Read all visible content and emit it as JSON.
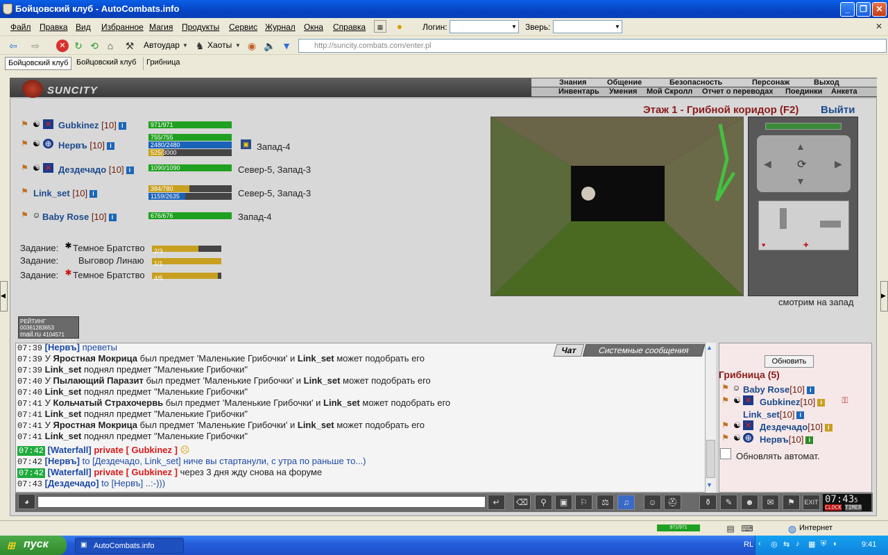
{
  "window": {
    "title": "Бойцовский клуб - AutoCombats.info"
  },
  "menu": {
    "items": [
      "Файл",
      "Правка",
      "Вид",
      "Избранное",
      "Магия",
      "Продукты",
      "Сервис",
      "Журнал",
      "Окна",
      "Справка"
    ],
    "login_label": "Логин:",
    "beast_label": "Зверь:"
  },
  "toolbar": {
    "autoudar": "Автоудар",
    "haoty": "Хаоты",
    "address": "http://suncity.combats.com/enter.pl"
  },
  "tabs": [
    "Бойцовский клуб",
    "Бойцовский клуб",
    "Грибница"
  ],
  "game": {
    "logo": "SUNCITY",
    "nav_top": [
      "Знания",
      "Общение",
      "Безопасность",
      "Персонаж",
      "Выход"
    ],
    "nav_bottom": [
      "Инвентарь",
      "Умения",
      "Мой Скролл",
      "Отчет о переводах",
      "Поединки",
      "Анкета"
    ],
    "floor": "Этаж 1 - Грибной коридор (F2)",
    "exit": "Выйти",
    "looking": "смотрим на запад",
    "party": [
      {
        "name": "Gubkinez",
        "level": "[10]",
        "hp": "971/971",
        "hp_frac": 1.0,
        "location": ""
      },
      {
        "name": "Нервъ",
        "level": "[10]",
        "hp": "755/755",
        "hp_frac": 1.0,
        "mana": "2480/2480",
        "mana_frac": 1.0,
        "extra": "525/3000",
        "extra_frac": 0.18,
        "location": "Запад-4"
      },
      {
        "name": "Дездечадо",
        "level": "[10]",
        "hp": "1090/1090",
        "hp_frac": 1.0,
        "location": "Север-5, Запад-3"
      },
      {
        "name": "Link_set",
        "level": "[10]",
        "hp": "384/780",
        "hp_frac": 0.49,
        "mana": "1159/2635",
        "mana_frac": 0.44,
        "location": "Север-5, Запад-3"
      },
      {
        "name": "Baby Rose",
        "level": "[10]",
        "hp": "676/676",
        "hp_frac": 1.0,
        "location": "Запад-4"
      }
    ],
    "quests": [
      {
        "label": "Задание:",
        "name": "Темное Братство",
        "progress": "2/3",
        "frac": 0.67
      },
      {
        "label": "Задание:",
        "name": "Выговор Линаю",
        "progress": "1/1",
        "frac": 1.0
      },
      {
        "label": "Задание:",
        "name": "Темное Братство",
        "progress": "4/5",
        "frac": 0.95
      }
    ],
    "rating": {
      "label": "РЕЙТИНГ",
      "v1": "00361283653",
      "v2": "4104571",
      "v3": "15321",
      "brand": "mail.ru"
    },
    "chat_tabs": [
      "Чат",
      "Системные сообщения"
    ],
    "chat": [
      {
        "time": "07:39",
        "a": "[Нервъ]",
        "b": " преветы"
      },
      {
        "time": "07:39",
        "pre": "У ",
        "who": "Яростная Мокрица",
        "mid": " был предмет 'Маленькие Грибочки' и ",
        "who2": "Link_set",
        "post": " может подобрать его"
      },
      {
        "time": "07:39",
        "who": "Link_set",
        "post": " поднял предмет \"Маленькие Грибочки\""
      },
      {
        "time": "07:40",
        "pre": "У ",
        "who": "Пылающий Паразит",
        "mid": " был предмет 'Маленькие Грибочки' и ",
        "who2": "Link_set",
        "post": " может подобрать его"
      },
      {
        "time": "07:40",
        "who": "Link_set",
        "post": " поднял предмет \"Маленькие Грибочки\""
      },
      {
        "time": "07:41",
        "pre": "У ",
        "who": "Кольчатый Страхочервь",
        "mid": " был предмет 'Маленькие Грибочки' и ",
        "who2": "Link_set",
        "post": " может подобрать его"
      },
      {
        "time": "07:41",
        "who": "Link_set",
        "post": " поднял предмет \"Маленькие Грибочки\""
      },
      {
        "time": "07:41",
        "pre": "У ",
        "who": "Яростная Мокрица",
        "mid": " был предмет 'Маленькие Грибочки' и ",
        "who2": "Link_set",
        "post": " может подобрать его"
      },
      {
        "time": "07:41",
        "who": "Link_set",
        "post": " поднял предмет \"Маленькие Грибочки\""
      }
    ],
    "chat_private": [
      {
        "time": "07:42",
        "who": "[Waterfall]",
        "priv": "private [ Gubkinez ]",
        "text": ""
      },
      {
        "time": "07:42",
        "who": "[Нервъ]",
        "to": " to [Дездечадо, Link_set] ниче вы стартанули, с утра по раньше то...)"
      },
      {
        "time": "07:42",
        "who": "[Waterfall]",
        "priv": "private [ Gubkinez ]",
        "text": " через 3 дня жду снова на форуме"
      },
      {
        "time": "07:43",
        "who": "[Дездечадо]",
        "to": " to [Нервъ] ..:-)))"
      }
    ],
    "side": {
      "refresh": "Обновить",
      "room": "Грибница (5)",
      "users": [
        {
          "name": "Baby Rose",
          "level": "[10]"
        },
        {
          "name": "Gubkinez",
          "level": "[10]"
        },
        {
          "name": "Link_set",
          "level": "[10]"
        },
        {
          "name": "Дездечадо",
          "level": "[10]"
        },
        {
          "name": "Нервъ",
          "level": "[10]"
        }
      ],
      "auto": "Обновлять автомат."
    },
    "clock": "07:43",
    "clock_sec": "5",
    "clock_labels": [
      "CLOCK",
      "TIMER"
    ]
  },
  "status": {
    "hp": "971/971",
    "zone": "Интернет"
  },
  "taskbar": {
    "start": "пуск",
    "task": "AutoCombats.info",
    "lang": "RL",
    "time": "9:41"
  }
}
